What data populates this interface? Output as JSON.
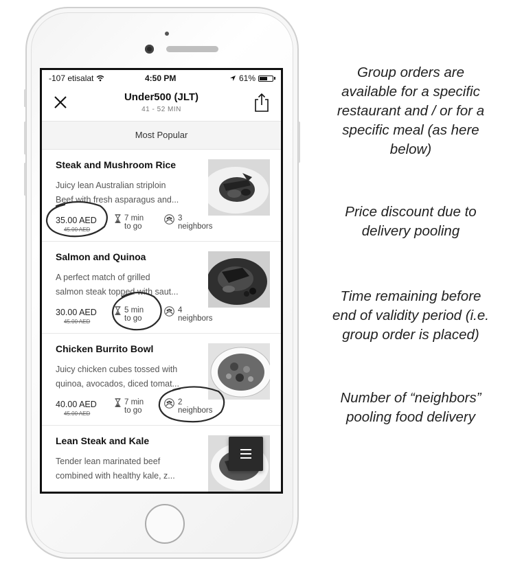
{
  "status_bar": {
    "carrier": "-107 etisalat",
    "time": "4:50 PM",
    "battery": "61%",
    "battery_level": 0.61
  },
  "header": {
    "title": "Under500 (JLT)",
    "subtitle": "41 - 52 MIN"
  },
  "section": {
    "label": "Most Popular"
  },
  "menu_items": [
    {
      "title": "Steak and Mushroom Rice",
      "desc_line1": "Juicy lean Australian striploin",
      "desc_line2": "Beef with fresh asparagus and...",
      "price": "35.00 AED",
      "old_price": "45.00 AED",
      "time_line1": "7 min",
      "time_line2": "to go",
      "neighbors_line1": "3",
      "neighbors_line2": "neighbors"
    },
    {
      "title": "Salmon and Quinoa",
      "desc_line1": "A perfect match of grilled",
      "desc_line2": "salmon steak topped with saut...",
      "price": "30.00 AED",
      "old_price": "45.00 AED",
      "time_line1": "5 min",
      "time_line2": "to go",
      "neighbors_line1": "4",
      "neighbors_line2": "neighbors"
    },
    {
      "title": "Chicken Burrito Bowl",
      "desc_line1": "Juicy chicken cubes tossed with",
      "desc_line2": "quinoa, avocados, diced tomat...",
      "price": "40.00 AED",
      "old_price": "45.00 AED",
      "time_line1": "7 min",
      "time_line2": "to go",
      "neighbors_line1": "2",
      "neighbors_line2": "neighbors"
    },
    {
      "title": "Lean Steak and Kale",
      "desc_line1": "Tender lean marinated beef",
      "desc_line2": "combined with healthy kale, z..."
    }
  ],
  "annotations": {
    "group_orders": [
      "Group orders are",
      "available for a specific",
      "restaurant and / or for a",
      "specific meal (as here",
      "below)"
    ],
    "price_discount": [
      "Price discount due to",
      "delivery pooling"
    ],
    "time_remaining": [
      "Time remaining before",
      "end of validity period (i.e.",
      "group order is placed)"
    ],
    "neighbors": [
      "Number of “neighbors”",
      "pooling food delivery"
    ]
  },
  "icons": {
    "close": "close-icon",
    "share": "share-icon",
    "hourglass": "hourglass-icon",
    "neighbors": "neighbors-icon",
    "menu": "hamburger-menu-icon",
    "wifi": "wifi-icon",
    "location": "location-arrow-icon",
    "battery": "battery-icon"
  }
}
